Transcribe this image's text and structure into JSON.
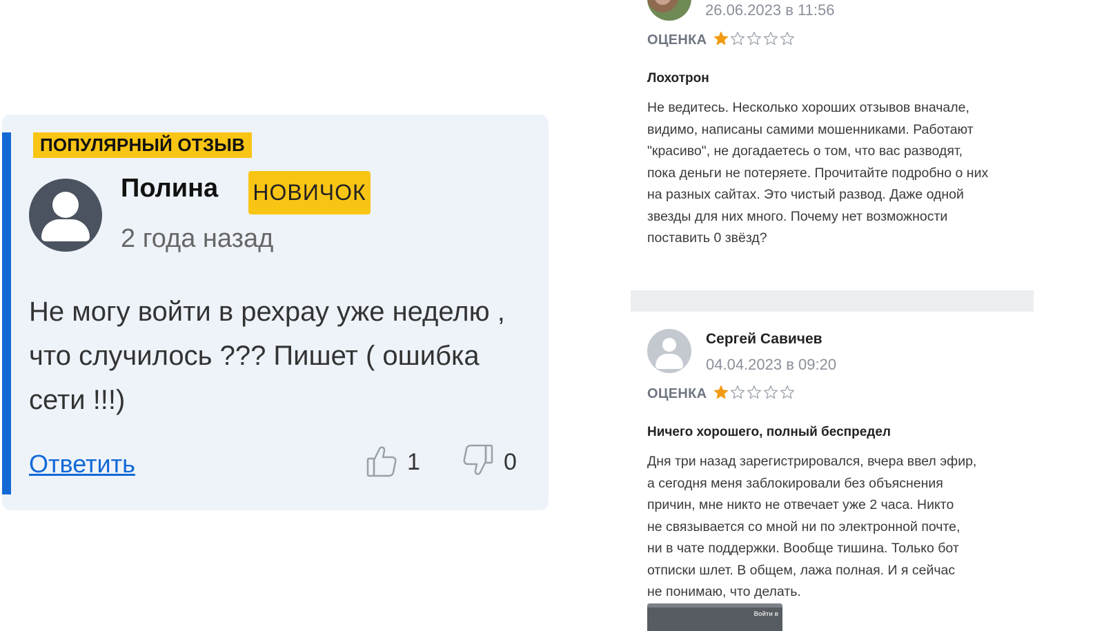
{
  "popular_review": {
    "badge": "ПОПУЛЯРНЫЙ ОТЗЫВ",
    "author": "Полина",
    "level": "НОВИЧОК",
    "time_ago": "2 года назад",
    "text": "Не могу войти в рехрау уже неделю , что случилось ??? Пишет ( ошибка сети !!!)",
    "reply_label": "Ответить",
    "likes": "1",
    "dislikes": "0"
  },
  "reviews": [
    {
      "date": "26.06.2023 в 11:56",
      "rating_label": "ОЦЕНКА",
      "rating": 1,
      "max_rating": 5,
      "title": "Лохотрон",
      "text": "Не ведитесь. Несколько хороших отзывов вначале,\nвидимо, написаны самими мошенниками. Работают\n\"красиво\", не догадаетесь о том, что вас разводят,\nпока деньги не потеряете. Прочитайте подробно о них\nна разных сайтах. Это чистый развод. Даже одной\nзвезды для них много. Почему нет возможности\nпоставить 0 звёзд?"
    },
    {
      "author": "Сергей Савичев",
      "date": "04.04.2023 в 09:20",
      "rating_label": "ОЦЕНКА",
      "rating": 1,
      "max_rating": 5,
      "title": "Ничего хорошего, полный беспредел",
      "text": "Дня три назад зарегистрировался, вчера ввел эфир,\nа сегодня меня заблокировали без объяснения\nпричин, мне никто не отвечает уже 2 часа. Никто\nне связывается со мной ни по электронной почте,\nни в чате поддержки. Вообще тишина. Только бот\nотписки шлет. В общем, лажа полная. И я сейчас\nне понимаю, что делать.",
      "attachment_caption": "Войти в"
    }
  ],
  "colors": {
    "accent_blue": "#1269d6",
    "badge_yellow": "#f9c515",
    "star_filled": "#f29a12",
    "star_empty": "#9aa1ab",
    "card_bg": "#eef3fa"
  },
  "icons": {
    "like": "thumbs-up-icon",
    "dislike": "thumbs-down-icon",
    "star": "star-icon"
  }
}
